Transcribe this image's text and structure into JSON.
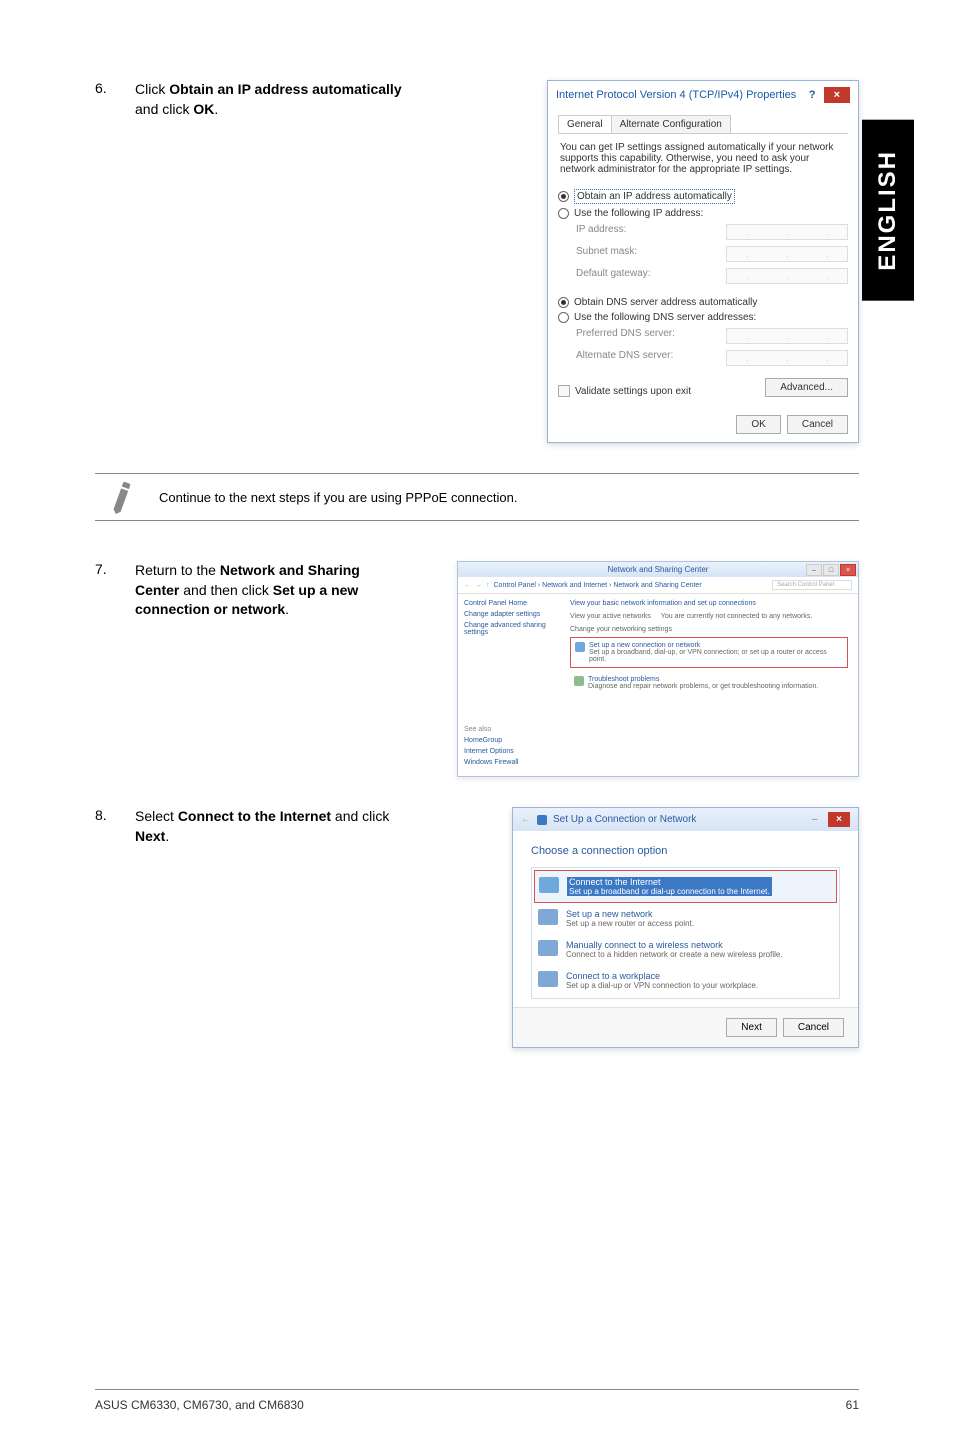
{
  "language_tab": "ENGLISH",
  "step6": {
    "num": "6.",
    "text_parts": [
      "Click ",
      "Obtain an IP address automatically",
      " and click ",
      "OK",
      "."
    ]
  },
  "ipv4_dialog": {
    "title": "Internet Protocol Version 4 (TCP/IPv4) Properties",
    "help": "?",
    "close": "×",
    "tab_general": "General",
    "tab_alt": "Alternate Configuration",
    "desc": "You can get IP settings assigned automatically if your network supports this capability. Otherwise, you need to ask your network administrator for the appropriate IP settings.",
    "r_auto_ip": "Obtain an IP address automatically",
    "r_use_ip": "Use the following IP address:",
    "f_ip": "IP address:",
    "f_mask": "Subnet mask:",
    "f_gw": "Default gateway:",
    "r_auto_dns": "Obtain DNS server address automatically",
    "r_use_dns": "Use the following DNS server addresses:",
    "f_pref": "Preferred DNS server:",
    "f_alt": "Alternate DNS server:",
    "chk_validate": "Validate settings upon exit",
    "btn_adv": "Advanced...",
    "btn_ok": "OK",
    "btn_cancel": "Cancel"
  },
  "note": "Continue to the next steps if you are using PPPoE connection.",
  "step7": {
    "num": "7.",
    "text_parts": [
      "Return to the ",
      "Network and Sharing Center",
      " and then click ",
      "Set up a new connection or network",
      "."
    ]
  },
  "ns_window": {
    "title": "Network and Sharing Center",
    "path": "Control Panel  ›  Network and Internet  ›  Network and Sharing Center",
    "search_ph": "Search Control Panel",
    "side_home": "Control Panel Home",
    "side_adapter": "Change adapter settings",
    "side_sharing": "Change advanced sharing settings",
    "main_heading": "View your basic network information and set up connections",
    "active_label": "View your active networks",
    "active_status": "You are currently not connected to any networks.",
    "change_label": "Change your networking settings",
    "setup_title": "Set up a new connection or network",
    "setup_desc": "Set up a broadband, dial-up, or VPN connection; or set up a router or access point.",
    "troubleshoot_title": "Troubleshoot problems",
    "troubleshoot_desc": "Diagnose and repair network problems, or get troubleshooting information.",
    "seealso": "See also",
    "hg": "HomeGroup",
    "io": "Internet Options",
    "wf": "Windows Firewall"
  },
  "step8": {
    "num": "8.",
    "text_parts": [
      "Select ",
      "Connect to the Internet",
      " and click ",
      "Next",
      "."
    ]
  },
  "conn_window": {
    "title": "Set Up a Connection or Network",
    "close": "×",
    "heading": "Choose a connection option",
    "opt1_t": "Connect to the Internet",
    "opt1_d": "Set up a broadband or dial-up connection to the Internet.",
    "opt2_t": "Set up a new network",
    "opt2_d": "Set up a new router or access point.",
    "opt3_t": "Manually connect to a wireless network",
    "opt3_d": "Connect to a hidden network or create a new wireless profile.",
    "opt4_t": "Connect to a workplace",
    "opt4_d": "Set up a dial-up or VPN connection to your workplace.",
    "btn_next": "Next",
    "btn_cancel": "Cancel"
  },
  "footer": {
    "left": "ASUS CM6330, CM6730, and CM6830",
    "right": "61"
  }
}
